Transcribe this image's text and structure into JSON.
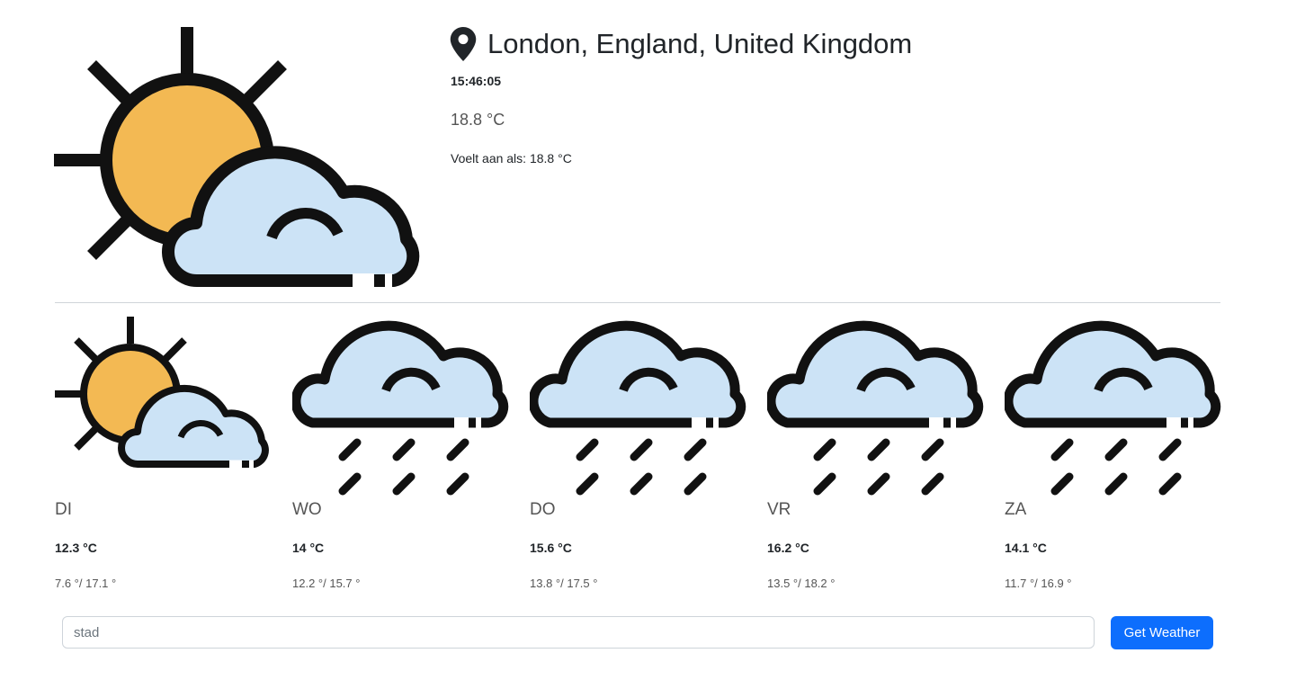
{
  "current": {
    "location": "London, England, United Kingdom",
    "time": "15:46:05",
    "temperature": "18.8 °C",
    "feels_like": "Voelt aan als: 18.8 °C",
    "icon": "sun-cloud-icon"
  },
  "forecast": [
    {
      "day": "DI",
      "temp": "12.3 °C",
      "range": "7.6 °/ 17.1 °",
      "icon": "sun-cloud-icon"
    },
    {
      "day": "WO",
      "temp": "14 °C",
      "range": "12.2 °/ 15.7 °",
      "icon": "rain-cloud-icon"
    },
    {
      "day": "DO",
      "temp": "15.6 °C",
      "range": "13.8 °/ 17.5 °",
      "icon": "rain-cloud-icon"
    },
    {
      "day": "VR",
      "temp": "16.2 °C",
      "range": "13.5 °/ 18.2 °",
      "icon": "rain-cloud-icon"
    },
    {
      "day": "ZA",
      "temp": "14.1 °C",
      "range": "11.7 °/ 16.9 °",
      "icon": "rain-cloud-icon"
    }
  ],
  "search": {
    "placeholder": "stad",
    "value": "",
    "button_label": "Get Weather"
  },
  "colors": {
    "sun": "#f3b953",
    "cloud": "#cce3f6",
    "outline": "#111111",
    "button": "#0d6efd"
  }
}
